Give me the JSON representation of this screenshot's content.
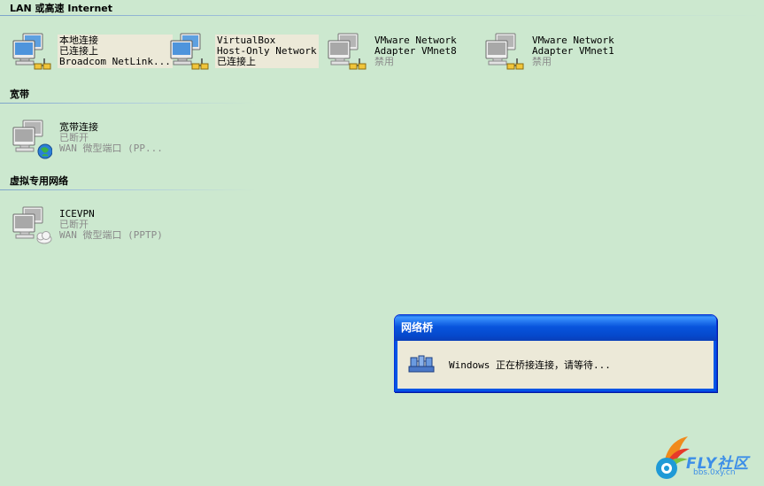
{
  "sections": {
    "lan": "LAN 或高速 Internet",
    "broadband": "宽带",
    "vpn": "虚拟专用网络"
  },
  "connections": {
    "local": {
      "name": "本地连接",
      "status": "已连接上",
      "device": "Broadcom NetLink..."
    },
    "virtualbox": {
      "name": "VirtualBox",
      "line2": "Host-Only Network",
      "status": "已连接上"
    },
    "vmnet8": {
      "name": "VMware Network",
      "line2": "Adapter VMnet8",
      "status": "禁用"
    },
    "vmnet1": {
      "name": "VMware Network",
      "line2": "Adapter VMnet1",
      "status": "禁用"
    },
    "broadband": {
      "name": "宽带连接",
      "status": "已断开",
      "device": "WAN 微型端口 (PP..."
    },
    "icevpn": {
      "name": "ICEVPN",
      "status": "已断开",
      "device": "WAN 微型端口 (PPTP)"
    }
  },
  "dialog": {
    "title": "网络桥",
    "message": "Windows 正在桥接连接，请等待..."
  },
  "watermark": {
    "brand": "FLY社区",
    "site": "bbs.0xy.cn"
  },
  "colors": {
    "background": "#cce8cf",
    "titlebar": "#0855dd",
    "selection": "#ece9d8"
  }
}
